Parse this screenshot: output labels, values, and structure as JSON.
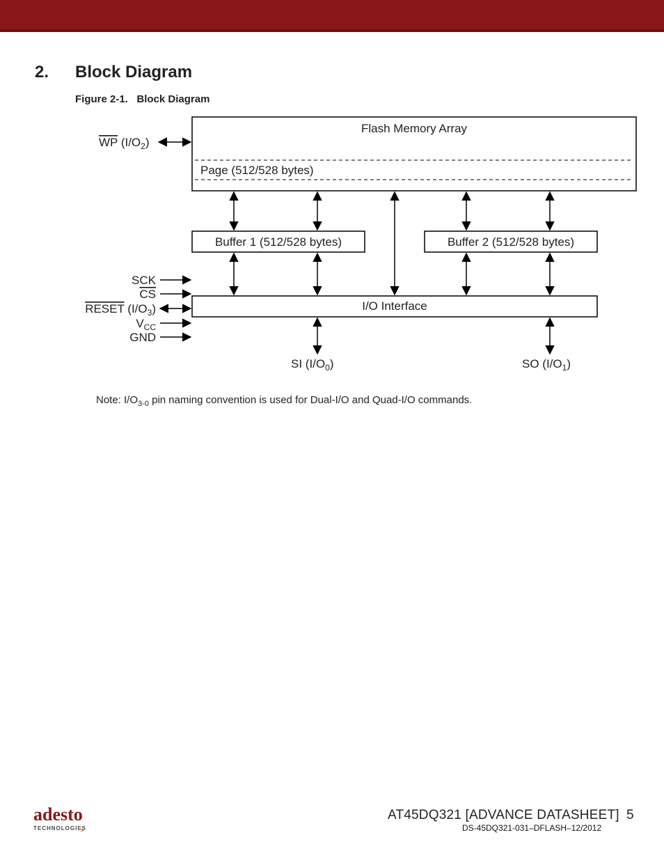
{
  "section": {
    "number": "2.",
    "title": "Block Diagram"
  },
  "figure": {
    "label": "Figure 2-1.",
    "name": "Block Diagram"
  },
  "diagram": {
    "flash_title": "Flash Memory Array",
    "page_label": "Page (512/528 bytes)",
    "buffer1": "Buffer 1 (512/528 bytes)",
    "buffer2": "Buffer 2 (512/528 bytes)",
    "io_interface": "I/O Interface",
    "pins": {
      "wp_name": "WP",
      "wp_io": "(I/O",
      "wp_idx": "2",
      "wp_close": ")",
      "sck": "SCK",
      "cs": "CS",
      "reset_name": "RESET",
      "reset_io": "(I/O",
      "reset_idx": "3",
      "reset_close": ")",
      "vcc_v": "V",
      "vcc_cc": "CC",
      "gnd": "GND",
      "si": "SI",
      "si_io": "(I/O",
      "si_idx": "0",
      "si_close": ")",
      "so": "SO",
      "so_io": "(I/O",
      "so_idx": "1",
      "so_close": ")"
    }
  },
  "note": {
    "prefix": "Note:  I/O",
    "range": "3-0",
    "suffix": " pin naming convention is used for Dual-I/O and Quad-I/O commands."
  },
  "footer": {
    "title": "AT45DQ321 [ADVANCE DATASHEET]",
    "docnum": "DS-45DQ321-031–DFLASH–12/2012",
    "page": "5",
    "logo_main": "adesto",
    "logo_sub": "TECHNOLOGIES"
  },
  "colors": {
    "brand": "#8a181b"
  }
}
